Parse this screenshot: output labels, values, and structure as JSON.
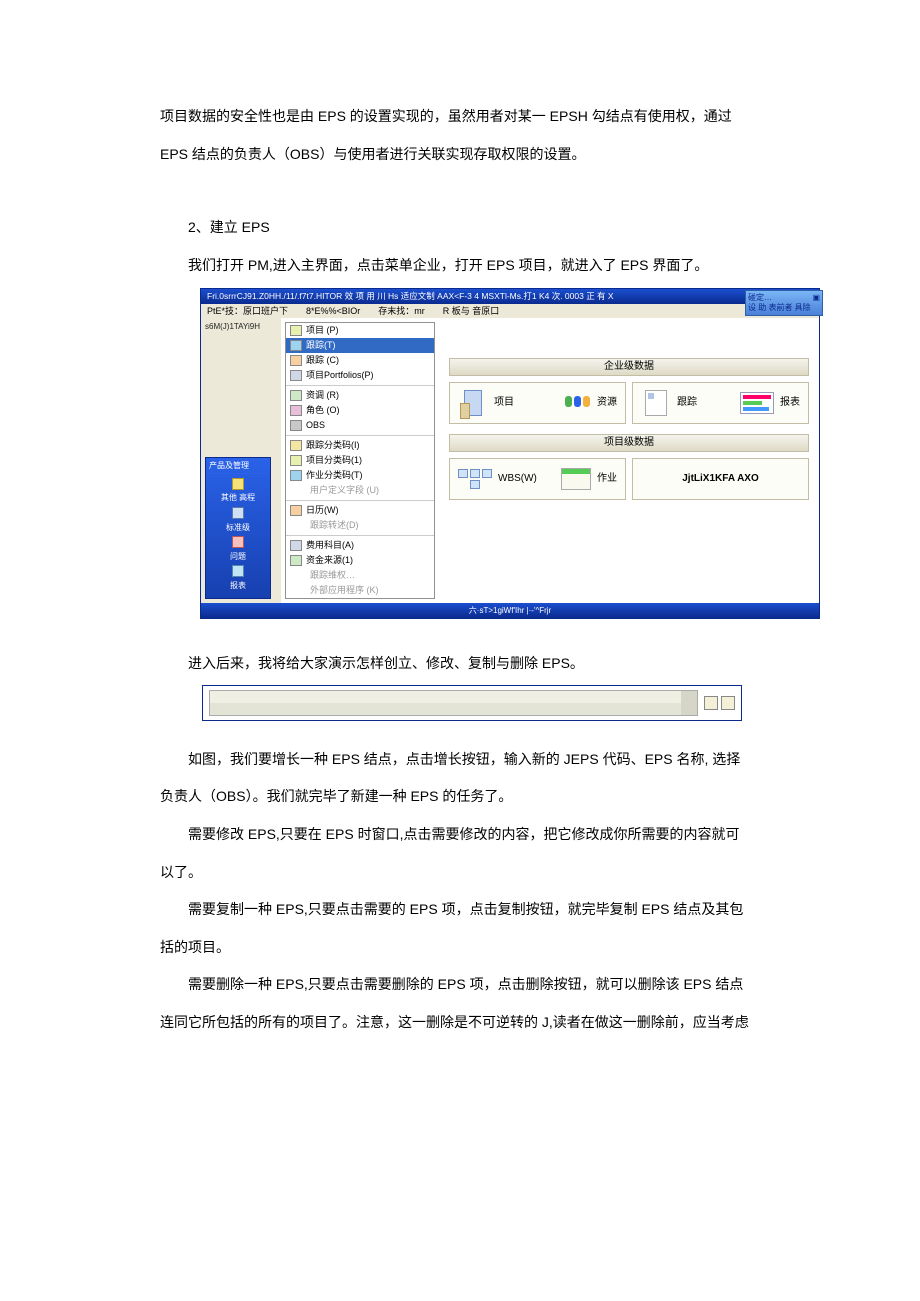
{
  "para1": "项目数据的安全性也是由 EPS 的设置实现的，虽然用者对某一 EPSH 勾结点有使用权，通过",
  "para2": "EPS 结点的负责人（OBS）与使用者进行关联实现存取权限的设置。",
  "heading2": "2、建立 EPS",
  "para3": "我们打开 PM,进入主界面，点击菜单企业，打开 EPS 项目，就进入了 EPS 界面了。",
  "para4": "进入后来，我将给大家演示怎样创立、修改、复制与删除 EPS。",
  "para5": "如图，我们要增长一种 EPS 结点，点击增长按钮，输入新的 JEPS 代码、EPS 名称, 选择",
  "para6": "负责人（OBS）。我们就完毕了新建一种 EPS 的任务了。",
  "para7": "需要修改 EPS,只要在 EPS 时窗口,点击需要修改的内容，把它修改成你所需要的内容就可",
  "para8": "以了。",
  "para9": "需要复制一种 EPS,只要点击需要的 EPS 项，点击复制按钮，就完毕复制 EPS 结点及其包",
  "para10": "括的项目。",
  "para11": "需要删除一种 EPS,只要点击需要删除的 EPS 项，点击删除按钮，就可以删除该 EPS 结点",
  "para12": "连同它所包括的所有的项目了。注意，这一删除是不可逆转的 J,读者在做这一删除前，应当考虑",
  "shot1": {
    "titlebar": "Fri.0srrrCJ91.Z0HH./11/.f7t7.HITOR 效  项  用  川 Hs 适应文制 AAX<F-3 4 MSXTl-Ms.打1 K4 次. 0003 正 有 X",
    "menu": {
      "m1": "PtE*技：原口班户下",
      "m2": "8*E%%<BIOr",
      "m3": "存末找：mr",
      "m4": "R 板与 音原口"
    },
    "leftcode": "s6M(J)1TAYi9H",
    "sidebar": {
      "title": "产品及管理",
      "i1": "其他\n高程",
      "i2": "标准级",
      "i3": "问题",
      "i4": "报表"
    },
    "dropdown": {
      "d1": "项目 (P)",
      "d2": "跟踪(T)",
      "d3": "跟踪 (C)",
      "d4": "项目Portfolios(P)",
      "d5": "资调 (R)",
      "d6": "角色 (O)",
      "d7": "OBS",
      "d8": "跟踪分类码(I)",
      "d9": "项目分类码(1)",
      "d10": "作业分类码(T)",
      "d11": "用户定义字段 (U)",
      "d12": "日历(W)",
      "d13": "跟踪转述(D)",
      "d14": "费用科目(A)",
      "d15": "资金来源(1)",
      "d16": "跟踪维权…",
      "d17": "外部应用程序 (K)"
    },
    "sections": {
      "s1": "企业级数据",
      "s2": "项目级数据"
    },
    "cards": {
      "c1": "项目",
      "c2": "资源",
      "c3": "跟踪",
      "c4": "报表",
      "c5": "WBS(W)",
      "c6": "作业",
      "c7": "JjtLiX1KFA AXO"
    },
    "floatbox": {
      "r1": "碰定…",
      "r2": "设 助   表前者  具除"
    },
    "status": "六·sT>1giWf'Ihr |·-'^Frjr"
  }
}
